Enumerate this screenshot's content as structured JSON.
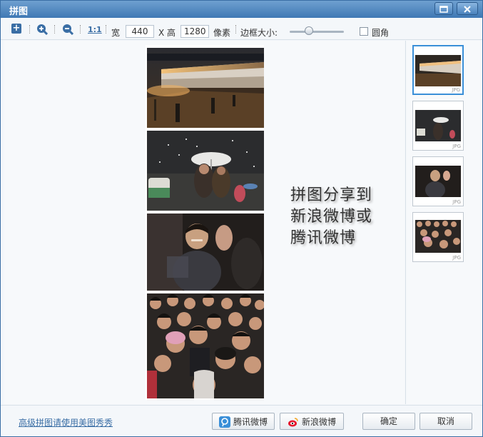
{
  "window": {
    "title": "拼图",
    "maximize_icon": "maximize-icon",
    "close_icon": "close-icon"
  },
  "toolbar": {
    "icons": [
      "add-icon",
      "zoom-in-icon",
      "zoom-out-icon"
    ],
    "actual_size_label": "1:1",
    "width_label": "宽",
    "width_value": "440",
    "height_label": "X 高",
    "height_value": "1280",
    "unit_label": "像素",
    "border_label": "边框大小:",
    "border_level": 0.35,
    "rounded_label": "圆角",
    "rounded_checked": false
  },
  "canvas": {
    "share_text": "拼图分享到新浪微博或腾讯微博"
  },
  "thumbnails": [
    {
      "badge": "JPG",
      "selected": true
    },
    {
      "badge": "JPG",
      "selected": false
    },
    {
      "badge": "JPG",
      "selected": false
    },
    {
      "badge": "JPG",
      "selected": false
    }
  ],
  "footer": {
    "advanced_link": "高级拼图请使用美图秀秀",
    "tencent_button": "腾讯微博",
    "sina_button": "新浪微博",
    "ok_button": "确定",
    "cancel_button": "取消"
  },
  "colors": {
    "title_bar": "#3f78b4",
    "accent": "#3a8fd8",
    "link": "#3a6ea5"
  }
}
